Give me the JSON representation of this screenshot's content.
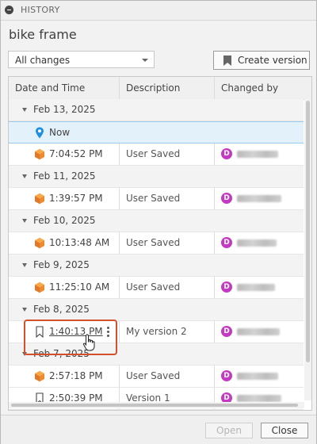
{
  "panel": {
    "title": "HISTORY"
  },
  "document": {
    "title": "bike frame"
  },
  "filter": {
    "selected": "All changes"
  },
  "toolbar": {
    "create_label": "Create version"
  },
  "table": {
    "headers": [
      "Date and Time",
      "Description",
      "Changed by"
    ],
    "rows": [
      {
        "kind": "group",
        "date": "Feb 13, 2025"
      },
      {
        "kind": "now",
        "time": "Now",
        "icon": "location-pin-icon"
      },
      {
        "kind": "item",
        "time": "7:04:52 PM",
        "desc": "User Saved",
        "avatar": "D",
        "icon": "cube-icon"
      },
      {
        "kind": "group",
        "date": "Feb 11, 2025"
      },
      {
        "kind": "item",
        "time": "1:39:57 PM",
        "desc": "User Saved",
        "avatar": "D",
        "icon": "cube-icon"
      },
      {
        "kind": "group",
        "date": "Feb 10, 2025"
      },
      {
        "kind": "item",
        "time": "10:13:48 AM",
        "desc": "User Saved",
        "avatar": "D",
        "icon": "cube-icon"
      },
      {
        "kind": "group",
        "date": "Feb 9, 2025"
      },
      {
        "kind": "item",
        "time": "11:25:10 AM",
        "desc": "User Saved",
        "avatar": "D",
        "icon": "cube-icon"
      },
      {
        "kind": "group",
        "date": "Feb 8, 2025"
      },
      {
        "kind": "item",
        "time": "1:40:13 PM",
        "desc": "My version 2",
        "avatar": "D",
        "icon": "bookmark-icon",
        "highlight": true
      },
      {
        "kind": "group",
        "date": "Feb 7, 2025"
      },
      {
        "kind": "item",
        "time": "2:57:18 PM",
        "desc": "User Saved",
        "avatar": "D",
        "icon": "cube-icon"
      },
      {
        "kind": "item",
        "time": "2:50:39 PM",
        "desc": "Version 1",
        "avatar": "D",
        "icon": "bookmark-icon"
      }
    ]
  },
  "footer": {
    "open_label": "Open",
    "close_label": "Close"
  },
  "colors": {
    "accent_orange": "#f0892a",
    "avatar": "#c23bc2",
    "pin": "#1f8fe0",
    "highlight": "#d4502a"
  }
}
